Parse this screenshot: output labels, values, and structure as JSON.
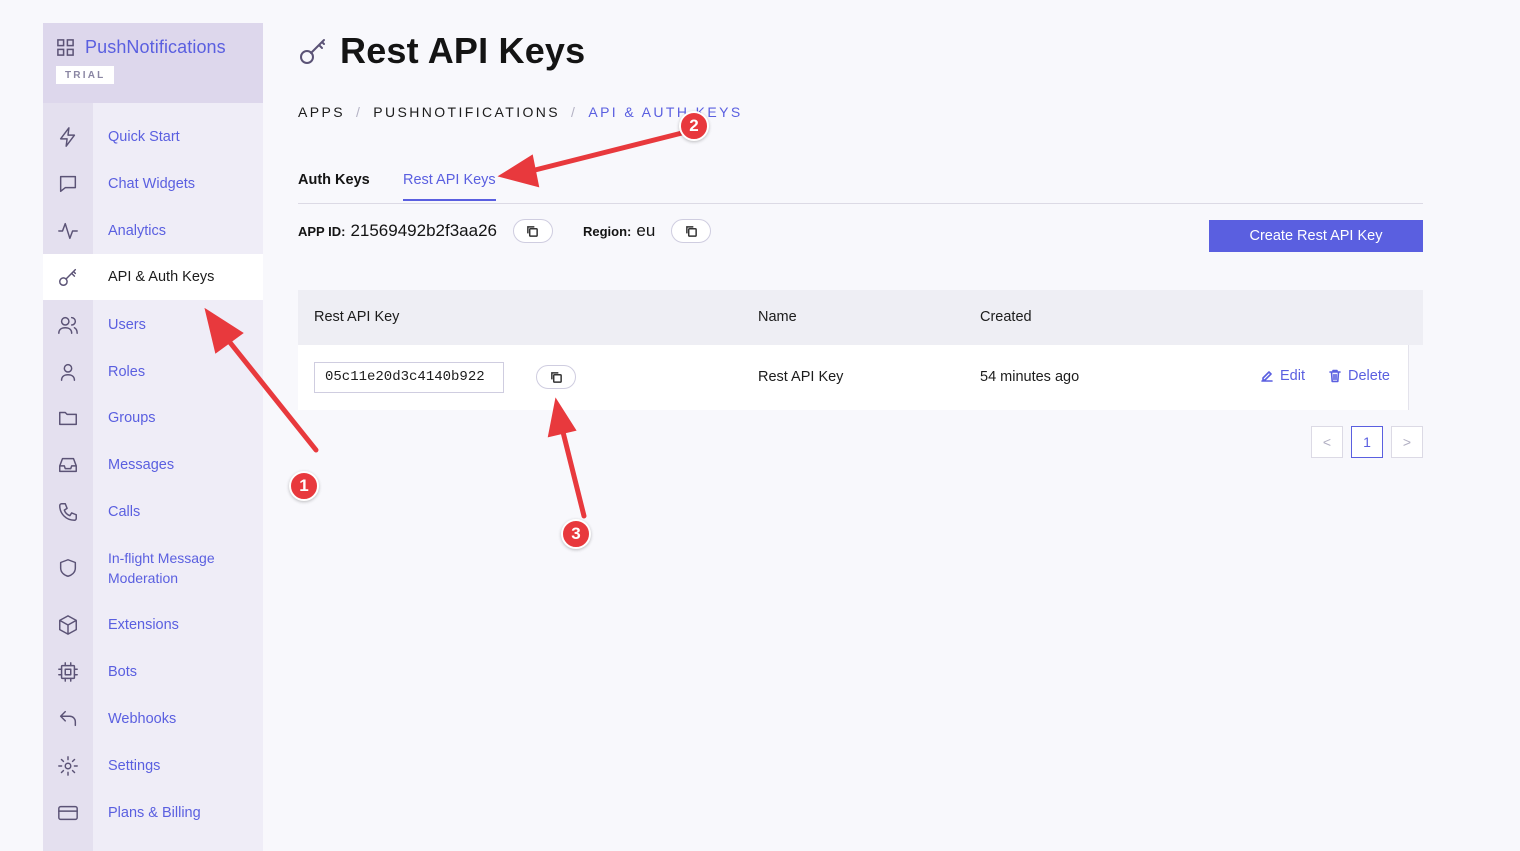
{
  "sidebar": {
    "app_name": "PushNotifications",
    "plan_badge": "TRIAL",
    "items": [
      {
        "label": "Quick Start",
        "icon": "bolt-icon"
      },
      {
        "label": "Chat Widgets",
        "icon": "chat-bubble-icon"
      },
      {
        "label": "Analytics",
        "icon": "activity-icon"
      },
      {
        "label": "API & Auth Keys",
        "icon": "key-icon",
        "active": true
      },
      {
        "label": "Users",
        "icon": "users-icon"
      },
      {
        "label": "Roles",
        "icon": "user-icon"
      },
      {
        "label": "Groups",
        "icon": "folder-icon"
      },
      {
        "label": "Messages",
        "icon": "inbox-icon"
      },
      {
        "label": "Calls",
        "icon": "phone-icon"
      },
      {
        "label": "In-flight Message Moderation",
        "icon": "shield-icon"
      },
      {
        "label": "Extensions",
        "icon": "cube-icon"
      },
      {
        "label": "Bots",
        "icon": "chip-icon"
      },
      {
        "label": "Webhooks",
        "icon": "reply-arrow-icon"
      },
      {
        "label": "Settings",
        "icon": "gear-icon"
      },
      {
        "label": "Plans & Billing",
        "icon": "credit-card-icon"
      }
    ]
  },
  "header": {
    "title": "Rest API Keys",
    "title_icon": "key-icon"
  },
  "breadcrumb": [
    "APPS",
    "PUSHNOTIFICATIONS",
    "API & AUTH KEYS"
  ],
  "tabs": [
    "Auth Keys",
    "Rest API Keys"
  ],
  "active_tab": "Rest API Keys",
  "meta": {
    "app_id_label": "APP ID:",
    "app_id": "21569492b2f3aa26",
    "region_label": "Region:",
    "region": "eu"
  },
  "create_button": "Create Rest API Key",
  "table": {
    "columns": [
      "Rest API Key",
      "Name",
      "Created"
    ],
    "rows": [
      {
        "key": "05c11e20d3c4140b922",
        "name": "Rest API Key",
        "created": "54 minutes ago"
      }
    ],
    "edit_label": "Edit",
    "delete_label": "Delete"
  },
  "pagination": {
    "current_page": "1",
    "prev": "<",
    "next": ">"
  },
  "annotations": {
    "badges": [
      "1",
      "2",
      "3"
    ],
    "color": "#e8393d"
  },
  "colors": {
    "accent": "#5a5fe0",
    "sidebar_bg": "#efedf7",
    "sidebar_head_bg": "#ddd7ec"
  }
}
